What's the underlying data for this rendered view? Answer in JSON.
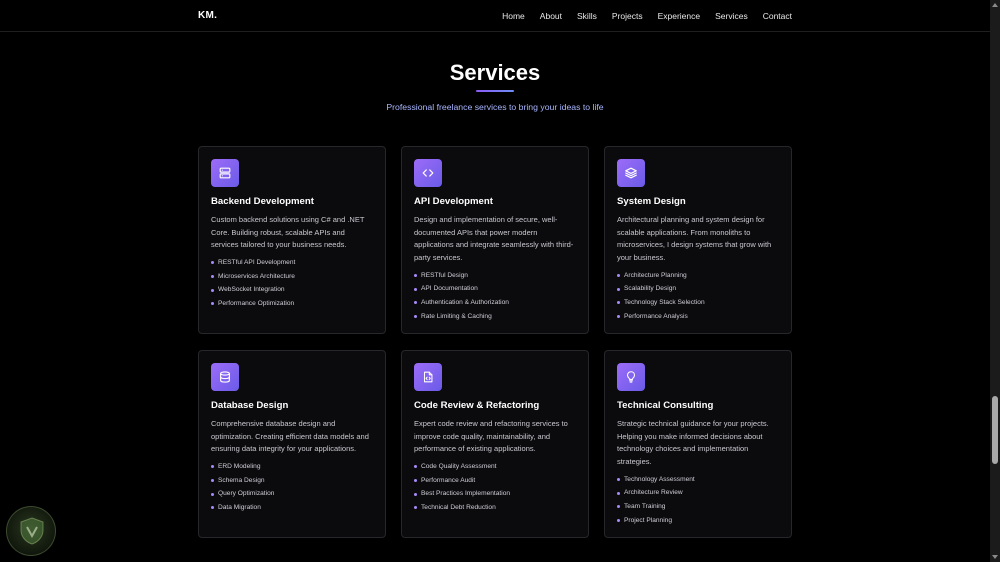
{
  "nav": {
    "logo": "KM.",
    "links": [
      "Home",
      "About",
      "Skills",
      "Projects",
      "Experience",
      "Services",
      "Contact"
    ]
  },
  "header": {
    "title": "Services",
    "subtitle": "Professional freelance services to bring your ideas to life"
  },
  "colors": {
    "accent": "#8b5cf6",
    "accent_secondary": "#6a5be8",
    "subtitle": "#a9b6ff",
    "card_bg": "#0b0b0e",
    "card_border": "#26262b",
    "bullet": "#a78bfa"
  },
  "services": [
    {
      "icon": "server-icon",
      "title": "Backend Development",
      "description": "Custom backend solutions using C# and .NET Core. Building robust, scalable APIs and services tailored to your business needs.",
      "features": [
        "RESTful API Development",
        "Microservices Architecture",
        "WebSocket Integration",
        "Performance Optimization"
      ]
    },
    {
      "icon": "code-icon",
      "title": "API Development",
      "description": "Design and implementation of secure, well-documented APIs that power modern applications and integrate seamlessly with third-party services.",
      "features": [
        "RESTful Design",
        "API Documentation",
        "Authentication & Authorization",
        "Rate Limiting & Caching"
      ]
    },
    {
      "icon": "layers-icon",
      "title": "System Design",
      "description": "Architectural planning and system design for scalable applications. From monoliths to microservices, I design systems that grow with your business.",
      "features": [
        "Architecture Planning",
        "Scalability Design",
        "Technology Stack Selection",
        "Performance Analysis"
      ]
    },
    {
      "icon": "database-icon",
      "title": "Database Design",
      "description": "Comprehensive database design and optimization. Creating efficient data models and ensuring data integrity for your applications.",
      "features": [
        "ERD Modeling",
        "Schema Design",
        "Query Optimization",
        "Data Migration"
      ]
    },
    {
      "icon": "file-code-icon",
      "title": "Code Review & Refactoring",
      "description": "Expert code review and refactoring services to improve code quality, maintainability, and performance of existing applications.",
      "features": [
        "Code Quality Assessment",
        "Performance Audit",
        "Best Practices Implementation",
        "Technical Debt Reduction"
      ]
    },
    {
      "icon": "lightbulb-icon",
      "title": "Technical Consulting",
      "description": "Strategic technical guidance for your projects. Helping you make informed decisions about technology choices and implementation strategies.",
      "features": [
        "Technology Assessment",
        "Architecture Review",
        "Team Training",
        "Project Planning"
      ]
    }
  ]
}
